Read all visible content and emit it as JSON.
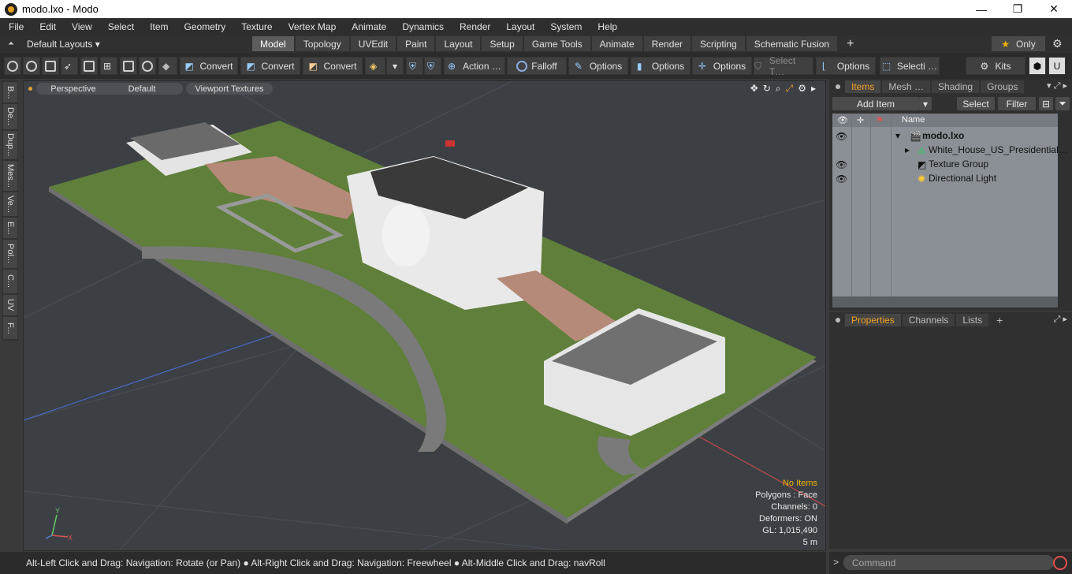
{
  "window": {
    "title": "modo.lxo - Modo",
    "minimize": "—",
    "maximize": "❐",
    "close": "✕"
  },
  "menu": [
    "File",
    "Edit",
    "View",
    "Select",
    "Item",
    "Geometry",
    "Texture",
    "Vertex Map",
    "Animate",
    "Dynamics",
    "Render",
    "Layout",
    "System",
    "Help"
  ],
  "layouts": {
    "label": "Default Layouts ▾"
  },
  "tabs": [
    "Model",
    "Topology",
    "UVEdit",
    "Paint",
    "Layout",
    "Setup",
    "Game Tools",
    "Animate",
    "Render",
    "Scripting",
    "Schematic Fusion"
  ],
  "active_tab": "Model",
  "only_label": "Only",
  "toolbar": {
    "convert1": "Convert",
    "convert2": "Convert",
    "convert3": "Convert",
    "action": "Action …",
    "falloff": "Falloff",
    "options1": "Options",
    "options2": "Options",
    "options3": "Options",
    "select_t": "Select T…",
    "options4": "Options",
    "selecti": "Selecti …",
    "kits": "Kits"
  },
  "left_tabs": [
    "B...",
    "De...",
    "Dup...",
    "Mes...",
    "Ve...",
    "E...",
    "Pol...",
    "C...",
    "UV",
    "F..."
  ],
  "viewport": {
    "perspective": "Perspective",
    "default": "Default",
    "textures": "Viewport Textures",
    "axis_y": "Y",
    "axis_x": "X",
    "stats": {
      "no_items": "No Items",
      "polygons": "Polygons : Face",
      "channels": "Channels: 0",
      "deformers": "Deformers: ON",
      "gl": "GL: 1,015,490",
      "scale": "5 m"
    }
  },
  "status": "Alt-Left Click and Drag: Navigation: Rotate (or Pan) ● Alt-Right Click and Drag: Navigation: Freewheel ● Alt-Middle Click and Drag: navRoll",
  "items_panel": {
    "tabs": [
      "Items",
      "Mesh …",
      "Shading",
      "Groups"
    ],
    "add_item": "Add Item",
    "select": "Select",
    "filter": "Filter",
    "name_header": "Name",
    "rows": [
      {
        "label": "modo.lxo"
      },
      {
        "label": "White_House_US_Presidential…"
      },
      {
        "label": "Texture Group"
      },
      {
        "label": "Directional Light"
      }
    ]
  },
  "properties_panel": {
    "tabs": [
      "Properties",
      "Channels",
      "Lists"
    ]
  },
  "command": {
    "placeholder": "Command"
  }
}
